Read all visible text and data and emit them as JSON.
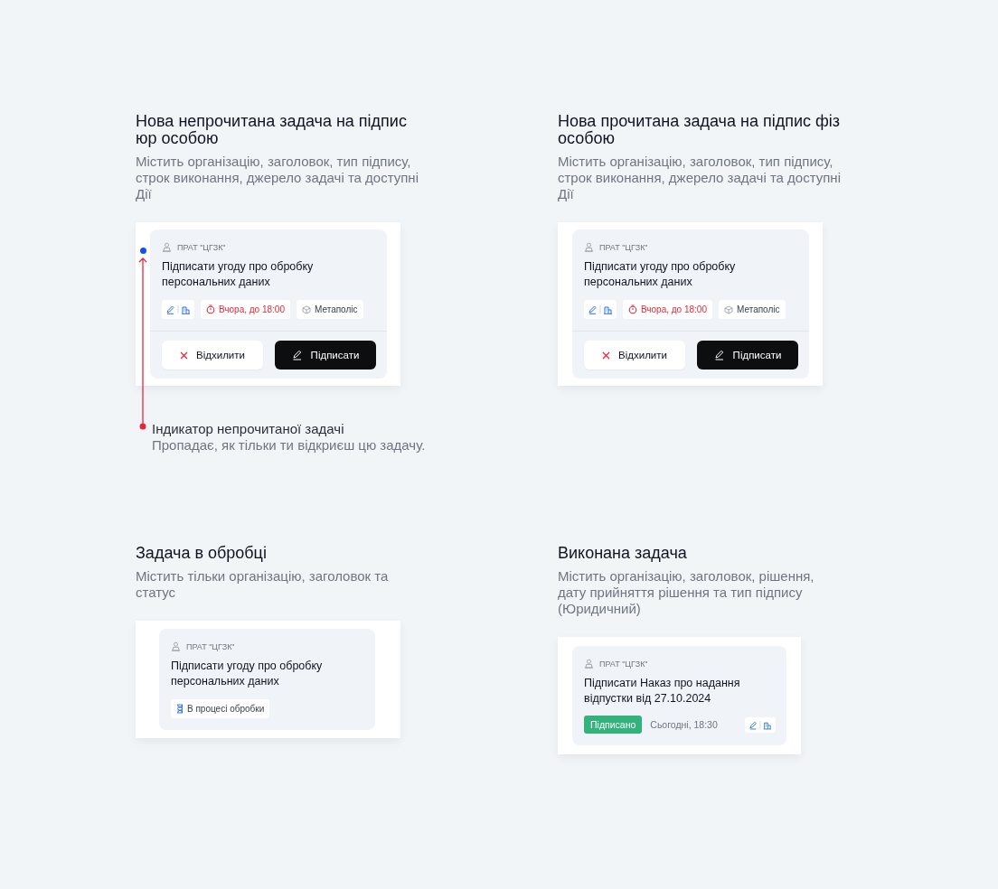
{
  "sections": [
    {
      "title": "Нова непрочитана задача на підпис юр особою",
      "description": "Містить організацію, заголовок, тип підпису, строк виконання, джерело задачі та доступні Дії",
      "unread": true,
      "annotation": {
        "title": "Індикатор непрочитаної задачі",
        "text": "Пропадає, як тільки ти відкриєш цю задачу."
      },
      "card": {
        "kind": "action",
        "org": "ПРАТ \"ЦГЗК\"",
        "title": "Підписати угоду про обробку персональних даних",
        "deadline": "Вчора, до 18:00",
        "source": "Метаполіс",
        "reject": "Відхилити",
        "sign": "Підписати"
      }
    },
    {
      "title": "Нова прочитана задача на підпис фіз особою",
      "description": "Містить організацію, заголовок, тип підпису, строк виконання, джерело задачі та доступні Дії",
      "unread": false,
      "card": {
        "kind": "action",
        "org": "ПРАТ \"ЦГЗК\"",
        "title": "Підписати угоду про обробку персональних даних",
        "deadline": "Вчора, до 18:00",
        "source": "Метаполіс",
        "reject": "Відхилити",
        "sign": "Підписати"
      }
    },
    {
      "title": "Задача в обробці",
      "description": "Містить тільки організацію, заголовок та статус",
      "unread": false,
      "card": {
        "kind": "processing",
        "org": "ПРАТ \"ЦГЗК\"",
        "title": "Підписати угоду про обробку персональних даних",
        "status": "В процесі обробки"
      }
    },
    {
      "title": "Виконана задача",
      "description": "Містить організацію, заголовок, рішення, дату прийняття рішення та тип підпису (Юридичний)",
      "unread": false,
      "card": {
        "kind": "done",
        "org": "ПРАТ \"ЦГЗК\"",
        "title": "Підписати Наказ про надання відпустки від 27.10.2024",
        "status": "Підписано",
        "date": "Сьогодні, 18:30"
      }
    }
  ]
}
